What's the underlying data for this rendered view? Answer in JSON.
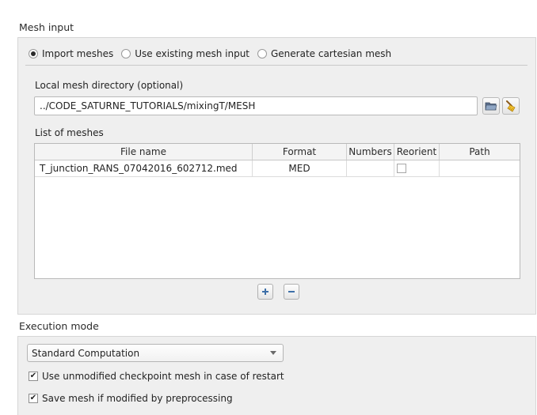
{
  "mesh_input": {
    "title": "Mesh input",
    "radios": [
      {
        "label": "Import meshes",
        "checked": true
      },
      {
        "label": "Use existing mesh input",
        "checked": false
      },
      {
        "label": "Generate cartesian mesh",
        "checked": false
      }
    ],
    "local_dir_label": "Local mesh directory (optional)",
    "local_dir_value": "../CODE_SATURNE_TUTORIALS/mixingT/MESH",
    "browse_icon": "folder-icon",
    "clear_icon": "broom-icon",
    "list_label": "List of meshes",
    "table": {
      "columns": [
        "File name",
        "Format",
        "Numbers",
        "Reorient",
        "Path"
      ],
      "rows": [
        {
          "file_name": "T_junction_RANS_07042016_602712.med",
          "format": "MED",
          "numbers": "",
          "reorient": false,
          "path": ""
        }
      ]
    },
    "add_icon": "plus-icon",
    "remove_icon": "minus-icon"
  },
  "execution_mode": {
    "title": "Execution mode",
    "selected": "Standard Computation",
    "checkboxes": [
      {
        "label": "Use unmodified checkpoint mesh in case of restart",
        "checked": true
      },
      {
        "label": "Save mesh if modified by preprocessing",
        "checked": true
      }
    ]
  }
}
